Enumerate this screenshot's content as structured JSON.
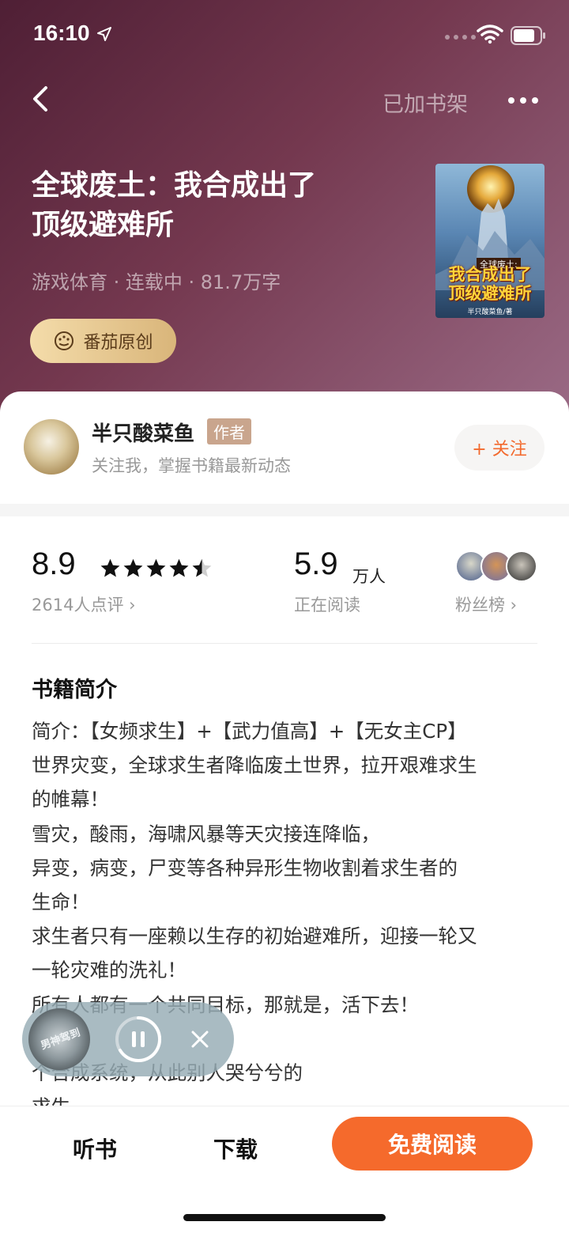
{
  "status_bar": {
    "time": "16:10"
  },
  "nav": {
    "shelf_label": "已加书架"
  },
  "book": {
    "title_line1": "全球废土：我合成出了",
    "title_line2": "顶级避难所",
    "meta": "游戏体育 · 连载中 · 81.7万字",
    "badge": "番茄原创",
    "cover": {
      "tag": "全球废土:",
      "title_line1": "我合成出了",
      "title_line2": "顶级避难所",
      "author": "半只酸菜鱼/著"
    }
  },
  "author": {
    "name": "半只酸菜鱼",
    "tag": "作者",
    "desc": "关注我，掌握书籍最新动态",
    "follow_label": "+ 关注"
  },
  "stats": {
    "rating": "8.9",
    "rating_stars": 4.5,
    "rating_count": "2614人点评 ›",
    "readers": "5.9",
    "readers_unit": "万人",
    "readers_label": "正在阅读",
    "fans_label": "粉丝榜 ›"
  },
  "intro": {
    "title": "书籍简介",
    "lines": [
      "简介：【女频求生】+【武力值高】+【无女主CP】",
      "世界灾变，全球求生者降临废土世界，拉开艰难求生",
      "的帷幕！",
      "雪灾，酸雨，海啸风暴等天灾接连降临，",
      "异变，病变，尸变等各种异形生物收割着求生者的",
      "生命！",
      "求生者只有一座赖以生存的初始避难所，迎接一轮又",
      "一轮灾难的洗礼！",
      "所有人都有一个共同目标，那就是，活下去！",
      "                              员，",
      "               个合成系统，从此别人哭兮兮的",
      "求生。"
    ]
  },
  "player": {
    "disc_text": "男神驾到"
  },
  "bottom_bar": {
    "listen_label": "听书",
    "download_label": "下载",
    "read_label": "免费阅读"
  },
  "colors": {
    "accent": "#f56a2c",
    "hero_dark": "#4f1f35",
    "hero_light": "#9a6a85"
  }
}
